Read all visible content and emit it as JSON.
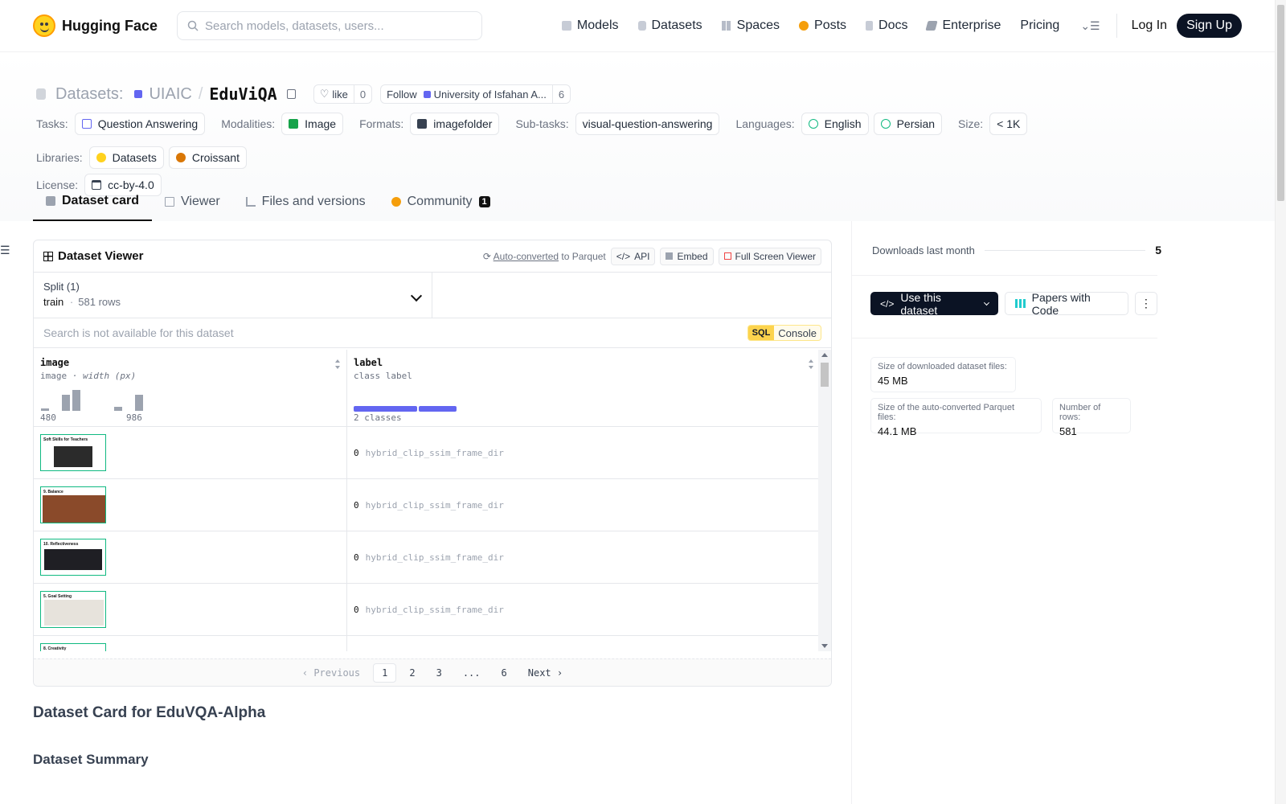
{
  "nav": {
    "brand": "Hugging Face",
    "search_placeholder": "Search models, datasets, users...",
    "links": [
      "Models",
      "Datasets",
      "Spaces",
      "Posts",
      "Docs",
      "Enterprise",
      "Pricing"
    ],
    "login": "Log In",
    "signup": "Sign Up"
  },
  "header": {
    "section": "Datasets:",
    "org": "UIAIC",
    "slash": "/",
    "repo": "EduViQA",
    "like_label": "like",
    "like_count": "0",
    "follow_label": "Follow",
    "follow_org": "University of Isfahan A...",
    "follow_count": "6",
    "tags": {
      "tasks_label": "Tasks:",
      "tasks": [
        "Question Answering"
      ],
      "modalities_label": "Modalities:",
      "modalities": [
        "Image"
      ],
      "formats_label": "Formats:",
      "formats": [
        "imagefolder"
      ],
      "subtasks_label": "Sub-tasks:",
      "subtasks": [
        "visual-question-answering"
      ],
      "languages_label": "Languages:",
      "languages": [
        "English",
        "Persian"
      ],
      "size_label": "Size:",
      "size": [
        "< 1K"
      ],
      "libraries_label": "Libraries:",
      "libraries": [
        "Datasets",
        "Croissant"
      ],
      "license_label": "License:",
      "license": [
        "cc-by-4.0"
      ]
    },
    "tabs": [
      {
        "label": "Dataset card",
        "active": true
      },
      {
        "label": "Viewer"
      },
      {
        "label": "Files and versions"
      },
      {
        "label": "Community",
        "badge": "1"
      }
    ]
  },
  "viewer": {
    "title": "Dataset Viewer",
    "auto_converted": "Auto-converted",
    "to_parquet": "to Parquet",
    "api": "API",
    "embed": "Embed",
    "full_screen": "Full Screen Viewer",
    "split_label": "Split (1)",
    "split_name": "train",
    "split_dot": "·",
    "split_rows": "581 rows",
    "search_text": "Search is not available for this dataset",
    "sql": "SQL",
    "console": "Console",
    "columns": [
      {
        "name": "image",
        "type": "image",
        "sub": "· width (px)",
        "min_tick": "480",
        "max_tick": "986",
        "hist": [
          0.12,
          0.78,
          1.0,
          0.2,
          0.75
        ]
      },
      {
        "name": "label",
        "type": "class label",
        "sub": "2 classes",
        "class_split": [
          0.63,
          0.37
        ]
      }
    ],
    "rows": [
      {
        "caption": "Soft Skills for Teachers",
        "label_id": "0",
        "label_name": "hybrid_clip_ssim_frame_dir"
      },
      {
        "caption": "9. Balance",
        "label_id": "0",
        "label_name": "hybrid_clip_ssim_frame_dir"
      },
      {
        "caption": "10. Reflectiveness",
        "label_id": "0",
        "label_name": "hybrid_clip_ssim_frame_dir"
      },
      {
        "caption": "5. Goal Setting",
        "label_id": "0",
        "label_name": "hybrid_clip_ssim_frame_dir"
      },
      {
        "caption": "8. Creativity",
        "label_id": "",
        "label_name": ""
      }
    ],
    "pager": {
      "previous": "Previous",
      "pages": [
        "1",
        "2",
        "3",
        "...",
        "6"
      ],
      "current": "1",
      "next": "Next"
    }
  },
  "card": {
    "heading": "Dataset Card for EduVQA-Alpha",
    "summary_heading": "Dataset Summary"
  },
  "sidebar": {
    "downloads_label": "Downloads last month",
    "downloads_value": "5",
    "use_dataset": "Use this dataset",
    "papers_with_code": "Papers with Code",
    "stats": [
      {
        "label": "Size of downloaded dataset files:",
        "value": "45 MB"
      },
      {
        "label": "Size of the auto-converted Parquet files:",
        "value": "44.1 MB"
      },
      {
        "label": "Number of rows:",
        "value": "581"
      }
    ]
  },
  "colors": {
    "accent": "#6366f1",
    "dark": "#0b1324",
    "thumb_border": "#10b981"
  }
}
